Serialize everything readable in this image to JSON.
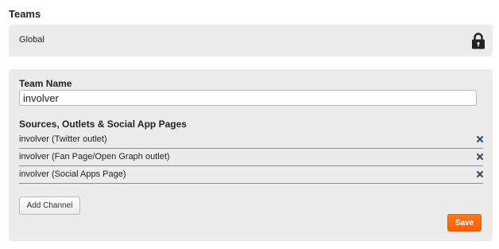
{
  "page": {
    "heading": "Teams"
  },
  "global": {
    "label": "Global",
    "icon": "lock-icon"
  },
  "team": {
    "name_label": "Team Name",
    "name_value": "involver",
    "sources_label": "Sources, Outlets & Social App Pages",
    "sources": [
      {
        "label": "involver (Twitter outlet)",
        "icon": "close-icon"
      },
      {
        "label": "involver (Fan Page/Open Graph outlet)",
        "icon": "close-icon"
      },
      {
        "label": "involver (Social Apps Page)",
        "icon": "close-icon"
      }
    ],
    "add_channel_label": "Add Channel",
    "save_label": "Save"
  },
  "colors": {
    "panel_bg": "#ececec",
    "save_accent": "#ff6600",
    "remove_icon": "#2b4a6f"
  }
}
